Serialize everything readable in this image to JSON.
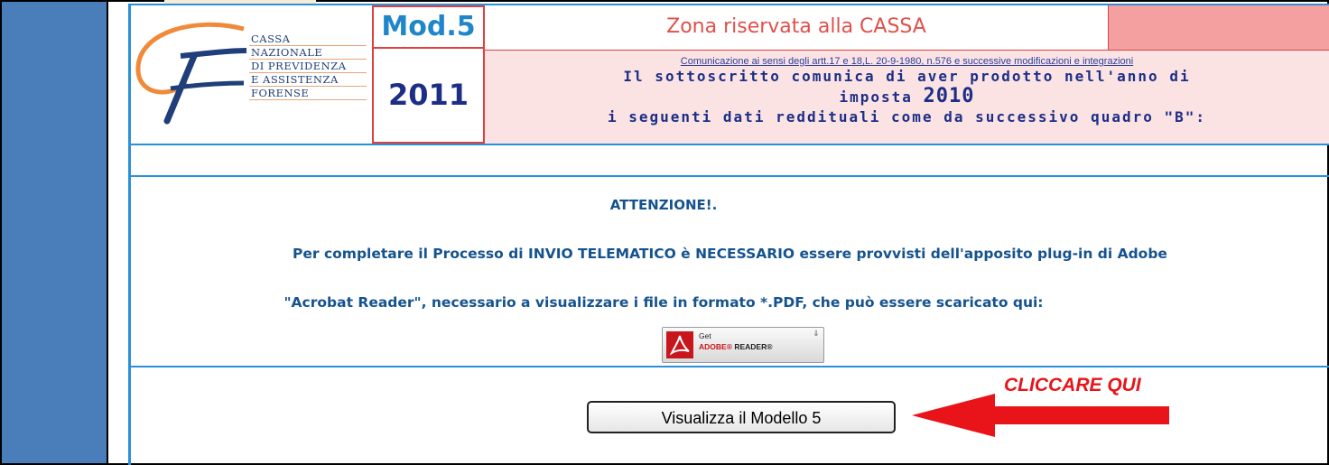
{
  "header": {
    "logo_lines": [
      "CASSA",
      "NAZIONALE",
      "DI PREVIDENZA",
      "E ASSISTENZA",
      "FORENSE"
    ],
    "mod_label": "Mod.5",
    "year": "2011",
    "reserved_zone": "Zona riservata alla CASSA",
    "legal_note": "Comunicazione ai sensi degli artt.17 e 18,L. 20-9-1980, n.576 e successive modificazioni e integrazioni",
    "statement_line1": "Il sottoscritto comunica di aver prodotto nell'anno di",
    "statement_line2_prefix": "imposta",
    "statement_tax_year": "2010",
    "statement_line3": "i seguenti dati reddituali come da successivo quadro \"B\":"
  },
  "notice": {
    "title": "ATTENZIONE!.",
    "line1": "Per completare il Processo di INVIO TELEMATICO è NECESSARIO essere provvisti dell'apposito plug-in di Adobe",
    "line2": "\"Acrobat Reader\", necessario a visualizzare i file in formato *.PDF, che può essere scaricato qui:"
  },
  "adobe_badge": {
    "get": "Get",
    "brand": "ADOBE",
    "product": "READER"
  },
  "actions": {
    "view_button": "Visualizza il Modello 5",
    "callout": "CLICCARE QUI"
  },
  "colors": {
    "sidebar": "#4a7ebb",
    "frame": "#2a90d8",
    "accent_red": "#e8141a",
    "text_blue": "#15538f"
  }
}
